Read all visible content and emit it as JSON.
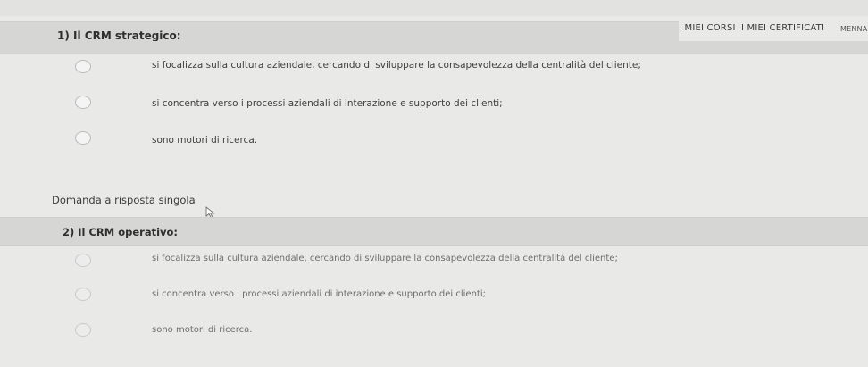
{
  "nav": {
    "my_courses": "I MIEI CORSI",
    "my_certificates": "I MIEI CERTIFICATI",
    "user": "MENNA C"
  },
  "questions": [
    {
      "title": "1) Il CRM strategico:",
      "options": [
        "si focalizza sulla cultura aziendale, cercando di sviluppare la consapevolezza della centralità del cliente;",
        "si concentra verso i processi aziendali di interazione e supporto dei clienti;",
        "sono motori di ricerca."
      ]
    },
    {
      "type_label": "Domanda a risposta singola",
      "title": "2) Il CRM operativo:",
      "options": [
        "si focalizza sulla cultura aziendale, cercando di sviluppare la consapevolezza della centralità del cliente;",
        "si concentra verso i processi aziendali di interazione e supporto dei clienti;",
        "sono motori di ricerca."
      ]
    }
  ]
}
